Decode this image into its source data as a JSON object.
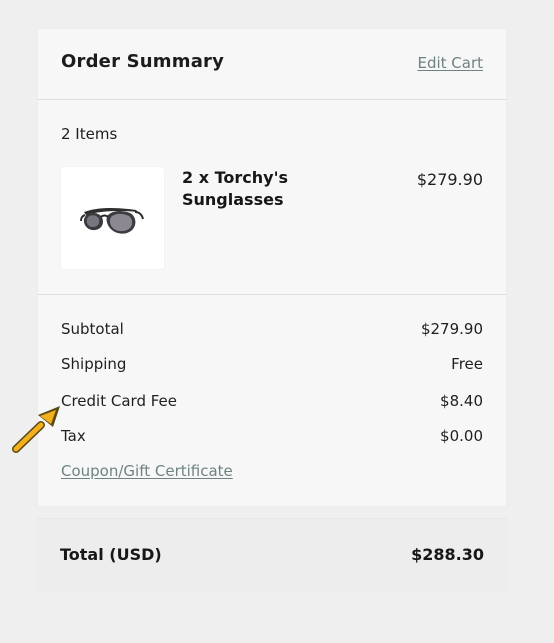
{
  "order_summary": {
    "title": "Order Summary",
    "edit_cart_label": "Edit Cart",
    "items_count": "2 Items",
    "product": {
      "name": "2 x Torchy's Sunglasses",
      "price": "$279.90",
      "image_icon": "sunglasses-icon"
    },
    "rows": {
      "subtotal": {
        "label": "Subtotal",
        "value": "$279.90"
      },
      "shipping": {
        "label": "Shipping",
        "value": "Free"
      },
      "credit_card_fee": {
        "label": "Credit Card Fee",
        "value": "$8.40"
      },
      "tax": {
        "label": "Tax",
        "value": "$0.00"
      }
    },
    "coupon_label": "Coupon/Gift Certificate",
    "total": {
      "label": "Total (USD)",
      "value": "$288.30"
    }
  },
  "annotation": {
    "icon": "annotation-arrow-icon",
    "color": "#f2b01e"
  },
  "colors": {
    "page_background": "#efefef",
    "card_background": "#f7f7f7",
    "link_color": "#6f8283",
    "total_background": "#ededed"
  }
}
